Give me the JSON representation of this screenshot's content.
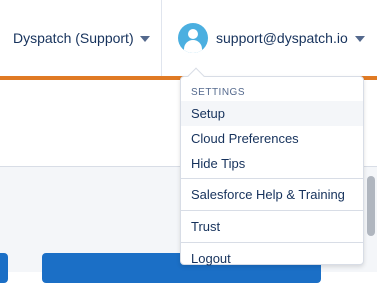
{
  "header": {
    "org_label": "Dyspatch (Support)",
    "user_label": "support@dyspatch.io",
    "accent_color": "#e07a24"
  },
  "dropdown": {
    "section_title": "SETTINGS",
    "items": [
      {
        "label": "Setup"
      },
      {
        "label": "Cloud Preferences"
      },
      {
        "label": "Hide Tips"
      },
      {
        "label": "Salesforce Help & Training"
      },
      {
        "label": "Trust"
      },
      {
        "label": "Logout"
      }
    ]
  },
  "icons": {
    "user": "user-avatar-icon",
    "caret": "chevron-down-icon"
  }
}
